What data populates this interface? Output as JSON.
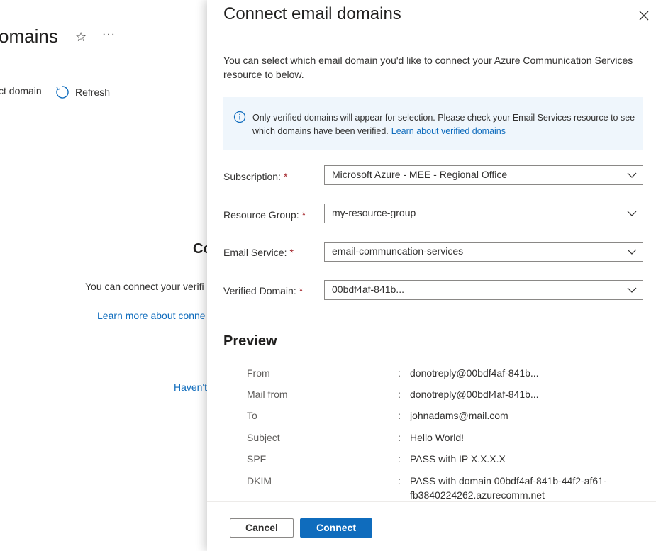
{
  "background": {
    "title": "omains",
    "star_icon": "star-icon",
    "more": "···",
    "cmd_connect": "ct domain",
    "cmd_refresh": "Refresh",
    "empty_title": "Co",
    "empty_desc": "You can connect your verifi",
    "empty_link": "Learn more about conne",
    "havent": "Haven't"
  },
  "panel": {
    "title": "Connect email domains",
    "intro": "You can select which email domain you'd like to connect your Azure Communication Services resource to below.",
    "info": {
      "icon": "info-icon",
      "text": "Only verified domains will appear for selection. Please check your Email Services resource to see which domains have been verified.",
      "link": "Learn about verified domains"
    },
    "form": {
      "subscription": {
        "label": "Subscription:",
        "required": "*",
        "value": "Microsoft Azure - MEE - Regional Office"
      },
      "resource_group": {
        "label": "Resource Group:",
        "required": "*",
        "value": "my-resource-group"
      },
      "email_service": {
        "label": "Email Service:",
        "required": "*",
        "value": "email-communcation-services"
      },
      "verified_domain": {
        "label": "Verified Domain:",
        "required": "*",
        "value": "00bdf4af-841b..."
      }
    },
    "preview": {
      "title": "Preview",
      "rows": [
        {
          "label": "From",
          "value": "donotreply@00bdf4af-841b..."
        },
        {
          "label": "Mail from",
          "value": "donotreply@00bdf4af-841b..."
        },
        {
          "label": "To",
          "value": "johnadams@mail.com"
        },
        {
          "label": "Subject",
          "value": "Hello World!"
        },
        {
          "label": "SPF",
          "value": "PASS with IP X.X.X.X"
        },
        {
          "label": "DKIM",
          "value": "PASS with domain 00bdf4af-841b-44f2-af61-fb3840224262.azurecomm.net"
        }
      ],
      "colon": ":"
    },
    "buttons": {
      "cancel": "Cancel",
      "connect": "Connect"
    }
  },
  "colors": {
    "accent": "#0f6cbd",
    "info_bg": "#eff6fc",
    "required": "#a4262c"
  }
}
